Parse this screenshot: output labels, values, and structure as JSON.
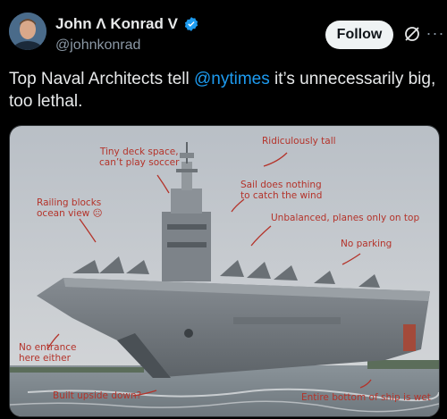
{
  "tweet": {
    "author_name": "John Λ Konrad V",
    "handle": "@johnkonrad",
    "follow_label": "Follow",
    "text_before": "Top Naval Architects tell ",
    "mention": "@nytimes",
    "text_after": " it’s unnecessarily big, too lethal."
  },
  "icons": {
    "verified": "verified-badge-icon",
    "grok": "grok-icon",
    "more": "more-options-icon",
    "avatar": "avatar"
  },
  "colors": {
    "background": "#000000",
    "text": "#e7e9ea",
    "secondary": "#8b98a5",
    "accent": "#1d9bf0",
    "annotation": "#b4332a"
  },
  "annotations": {
    "tiny_deck": "Tiny deck space,\ncan’t play soccer",
    "ridiculously_tall": "Ridiculously tall",
    "sail": "Sail does nothing\nto catch the wind",
    "railing": "Railing blocks\nocean view ☹",
    "unbalanced": "Unbalanced, planes only on top",
    "no_parking": "No parking",
    "no_entrance": "No entrance\nhere either",
    "upside_down": "Built upside down?",
    "bottom_wet": "Entire bottom of ship is wet"
  }
}
